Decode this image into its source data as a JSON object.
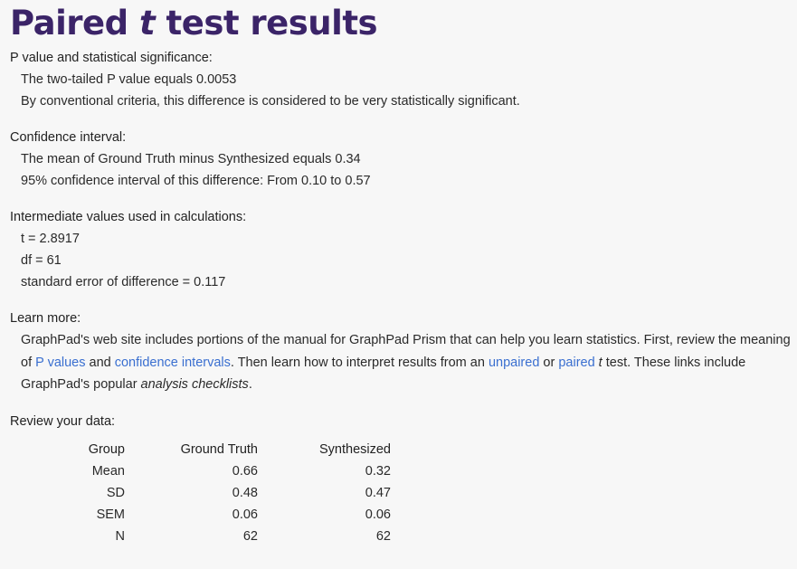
{
  "title": {
    "prefix": "Paired ",
    "italic": "t",
    "suffix": " test results"
  },
  "pvalue": {
    "heading": "P value and statistical significance:",
    "line1": "The two-tailed P value equals 0.0053",
    "line2": "By conventional criteria, this difference is considered to be very statistically significant."
  },
  "ci": {
    "heading": "Confidence interval:",
    "line1": "The mean of Ground Truth minus Synthesized equals 0.34",
    "line2": "95% confidence interval of this difference: From 0.10 to 0.57"
  },
  "intermediate": {
    "heading": "Intermediate values used in calculations:",
    "t": "t = 2.8917",
    "df": "df = 61",
    "se": "standard error of difference = 0.117"
  },
  "learn": {
    "heading": "Learn more:",
    "text1": "GraphPad's web site includes portions of the manual for GraphPad Prism that can help you learn statistics. First, review the meaning of ",
    "link_pvalues": "P values",
    "text2": " and ",
    "link_ci": "confidence intervals",
    "text3": ". Then learn how to interpret results from an ",
    "link_unpaired": "unpaired",
    "text4": " or ",
    "link_paired": "paired",
    "italic_t": " t",
    "text5": " test. These links include GraphPad's popular ",
    "link_checklists": "analysis checklists",
    "text6": "."
  },
  "review": {
    "heading": "Review your data:",
    "columns": [
      "Group",
      "Ground Truth",
      "Synthesized"
    ],
    "rows": [
      [
        "Mean",
        "0.66",
        "0.32"
      ],
      [
        "SD",
        "0.48",
        "0.47"
      ],
      [
        "SEM",
        "0.06",
        "0.06"
      ],
      [
        "N",
        "62",
        "62"
      ]
    ]
  }
}
